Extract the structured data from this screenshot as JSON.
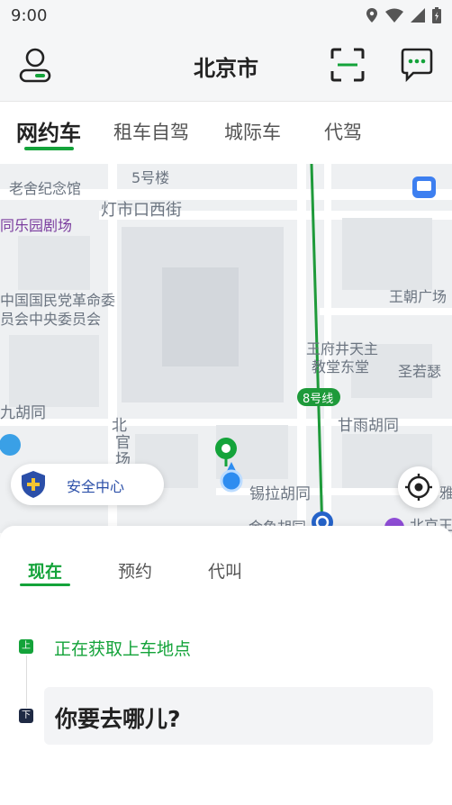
{
  "status_bar": {
    "time": "9:00"
  },
  "header": {
    "title": "北京市"
  },
  "service_tabs": [
    {
      "label": "网约车",
      "active": true
    },
    {
      "label": "租车自驾",
      "active": false
    },
    {
      "label": "城际车",
      "active": false
    },
    {
      "label": "代驾",
      "active": false
    }
  ],
  "map": {
    "labels": [
      {
        "text": "5号楼"
      },
      {
        "text": "老舍纪念馆"
      },
      {
        "text": "灯市口西街"
      },
      {
        "text": "同乐园剧场"
      },
      {
        "text": "中国国民党革命委"
      },
      {
        "text": "员会中央委员会"
      },
      {
        "text": "王朝广场"
      },
      {
        "text": "王府井天主"
      },
      {
        "text": "教堂东堂"
      },
      {
        "text": "圣若瑟"
      },
      {
        "text": "8号线"
      },
      {
        "text": "甘雨胡同"
      },
      {
        "text": "九胡同"
      },
      {
        "text": "北"
      },
      {
        "text": "官"
      },
      {
        "text": "场"
      },
      {
        "text": "锡拉胡同"
      },
      {
        "text": "金鱼胡同"
      },
      {
        "text": "北京王"
      },
      {
        "text": "雅"
      }
    ],
    "safety_center_label": "安全中心",
    "colors": {
      "metro_line": "#1e9a3a",
      "accent": "#14a33a",
      "pin": "#14a33a",
      "user_dot": "#2d8cf0"
    }
  },
  "booking": {
    "tabs": [
      {
        "label": "现在",
        "active": true
      },
      {
        "label": "预约",
        "active": false
      },
      {
        "label": "代叫",
        "active": false
      }
    ],
    "pickup_marker": "上",
    "pickup_text": "正在获取上车地点",
    "dropoff_marker": "下",
    "destination_placeholder": "你要去哪儿?"
  }
}
